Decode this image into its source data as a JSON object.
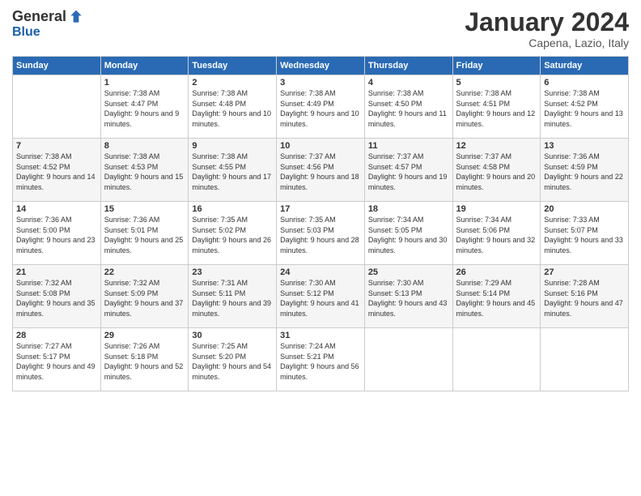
{
  "logo": {
    "general": "General",
    "blue": "Blue"
  },
  "title": "January 2024",
  "location": "Capena, Lazio, Italy",
  "days_header": [
    "Sunday",
    "Monday",
    "Tuesday",
    "Wednesday",
    "Thursday",
    "Friday",
    "Saturday"
  ],
  "weeks": [
    [
      {
        "day": "",
        "sunrise": "",
        "sunset": "",
        "daylight": ""
      },
      {
        "day": "1",
        "sunrise": "Sunrise: 7:38 AM",
        "sunset": "Sunset: 4:47 PM",
        "daylight": "Daylight: 9 hours and 9 minutes."
      },
      {
        "day": "2",
        "sunrise": "Sunrise: 7:38 AM",
        "sunset": "Sunset: 4:48 PM",
        "daylight": "Daylight: 9 hours and 10 minutes."
      },
      {
        "day": "3",
        "sunrise": "Sunrise: 7:38 AM",
        "sunset": "Sunset: 4:49 PM",
        "daylight": "Daylight: 9 hours and 10 minutes."
      },
      {
        "day": "4",
        "sunrise": "Sunrise: 7:38 AM",
        "sunset": "Sunset: 4:50 PM",
        "daylight": "Daylight: 9 hours and 11 minutes."
      },
      {
        "day": "5",
        "sunrise": "Sunrise: 7:38 AM",
        "sunset": "Sunset: 4:51 PM",
        "daylight": "Daylight: 9 hours and 12 minutes."
      },
      {
        "day": "6",
        "sunrise": "Sunrise: 7:38 AM",
        "sunset": "Sunset: 4:52 PM",
        "daylight": "Daylight: 9 hours and 13 minutes."
      }
    ],
    [
      {
        "day": "7",
        "sunrise": "Sunrise: 7:38 AM",
        "sunset": "Sunset: 4:52 PM",
        "daylight": "Daylight: 9 hours and 14 minutes."
      },
      {
        "day": "8",
        "sunrise": "Sunrise: 7:38 AM",
        "sunset": "Sunset: 4:53 PM",
        "daylight": "Daylight: 9 hours and 15 minutes."
      },
      {
        "day": "9",
        "sunrise": "Sunrise: 7:38 AM",
        "sunset": "Sunset: 4:55 PM",
        "daylight": "Daylight: 9 hours and 17 minutes."
      },
      {
        "day": "10",
        "sunrise": "Sunrise: 7:37 AM",
        "sunset": "Sunset: 4:56 PM",
        "daylight": "Daylight: 9 hours and 18 minutes."
      },
      {
        "day": "11",
        "sunrise": "Sunrise: 7:37 AM",
        "sunset": "Sunset: 4:57 PM",
        "daylight": "Daylight: 9 hours and 19 minutes."
      },
      {
        "day": "12",
        "sunrise": "Sunrise: 7:37 AM",
        "sunset": "Sunset: 4:58 PM",
        "daylight": "Daylight: 9 hours and 20 minutes."
      },
      {
        "day": "13",
        "sunrise": "Sunrise: 7:36 AM",
        "sunset": "Sunset: 4:59 PM",
        "daylight": "Daylight: 9 hours and 22 minutes."
      }
    ],
    [
      {
        "day": "14",
        "sunrise": "Sunrise: 7:36 AM",
        "sunset": "Sunset: 5:00 PM",
        "daylight": "Daylight: 9 hours and 23 minutes."
      },
      {
        "day": "15",
        "sunrise": "Sunrise: 7:36 AM",
        "sunset": "Sunset: 5:01 PM",
        "daylight": "Daylight: 9 hours and 25 minutes."
      },
      {
        "day": "16",
        "sunrise": "Sunrise: 7:35 AM",
        "sunset": "Sunset: 5:02 PM",
        "daylight": "Daylight: 9 hours and 26 minutes."
      },
      {
        "day": "17",
        "sunrise": "Sunrise: 7:35 AM",
        "sunset": "Sunset: 5:03 PM",
        "daylight": "Daylight: 9 hours and 28 minutes."
      },
      {
        "day": "18",
        "sunrise": "Sunrise: 7:34 AM",
        "sunset": "Sunset: 5:05 PM",
        "daylight": "Daylight: 9 hours and 30 minutes."
      },
      {
        "day": "19",
        "sunrise": "Sunrise: 7:34 AM",
        "sunset": "Sunset: 5:06 PM",
        "daylight": "Daylight: 9 hours and 32 minutes."
      },
      {
        "day": "20",
        "sunrise": "Sunrise: 7:33 AM",
        "sunset": "Sunset: 5:07 PM",
        "daylight": "Daylight: 9 hours and 33 minutes."
      }
    ],
    [
      {
        "day": "21",
        "sunrise": "Sunrise: 7:32 AM",
        "sunset": "Sunset: 5:08 PM",
        "daylight": "Daylight: 9 hours and 35 minutes."
      },
      {
        "day": "22",
        "sunrise": "Sunrise: 7:32 AM",
        "sunset": "Sunset: 5:09 PM",
        "daylight": "Daylight: 9 hours and 37 minutes."
      },
      {
        "day": "23",
        "sunrise": "Sunrise: 7:31 AM",
        "sunset": "Sunset: 5:11 PM",
        "daylight": "Daylight: 9 hours and 39 minutes."
      },
      {
        "day": "24",
        "sunrise": "Sunrise: 7:30 AM",
        "sunset": "Sunset: 5:12 PM",
        "daylight": "Daylight: 9 hours and 41 minutes."
      },
      {
        "day": "25",
        "sunrise": "Sunrise: 7:30 AM",
        "sunset": "Sunset: 5:13 PM",
        "daylight": "Daylight: 9 hours and 43 minutes."
      },
      {
        "day": "26",
        "sunrise": "Sunrise: 7:29 AM",
        "sunset": "Sunset: 5:14 PM",
        "daylight": "Daylight: 9 hours and 45 minutes."
      },
      {
        "day": "27",
        "sunrise": "Sunrise: 7:28 AM",
        "sunset": "Sunset: 5:16 PM",
        "daylight": "Daylight: 9 hours and 47 minutes."
      }
    ],
    [
      {
        "day": "28",
        "sunrise": "Sunrise: 7:27 AM",
        "sunset": "Sunset: 5:17 PM",
        "daylight": "Daylight: 9 hours and 49 minutes."
      },
      {
        "day": "29",
        "sunrise": "Sunrise: 7:26 AM",
        "sunset": "Sunset: 5:18 PM",
        "daylight": "Daylight: 9 hours and 52 minutes."
      },
      {
        "day": "30",
        "sunrise": "Sunrise: 7:25 AM",
        "sunset": "Sunset: 5:20 PM",
        "daylight": "Daylight: 9 hours and 54 minutes."
      },
      {
        "day": "31",
        "sunrise": "Sunrise: 7:24 AM",
        "sunset": "Sunset: 5:21 PM",
        "daylight": "Daylight: 9 hours and 56 minutes."
      },
      {
        "day": "",
        "sunrise": "",
        "sunset": "",
        "daylight": ""
      },
      {
        "day": "",
        "sunrise": "",
        "sunset": "",
        "daylight": ""
      },
      {
        "day": "",
        "sunrise": "",
        "sunset": "",
        "daylight": ""
      }
    ]
  ]
}
